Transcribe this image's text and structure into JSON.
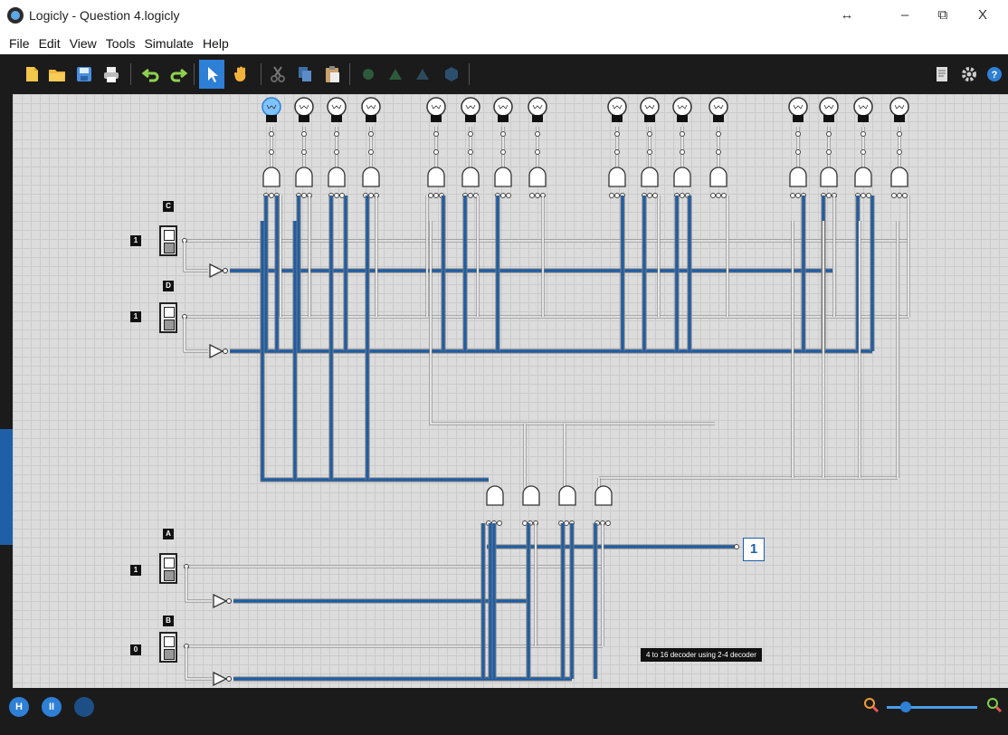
{
  "window": {
    "title": "Logicly - Question 4.logicly",
    "controls": {
      "resize": "↔",
      "minimize": "–",
      "restore": "⧉",
      "close": "X"
    }
  },
  "menu": [
    "File",
    "Edit",
    "View",
    "Tools",
    "Simulate",
    "Help"
  ],
  "toolbar": {
    "icons": [
      "new-file-icon",
      "open-folder-icon",
      "save-icon",
      "print-icon",
      "undo-icon",
      "redo-icon",
      "select-arrow-icon",
      "pan-hand-icon",
      "cut-icon",
      "copy-icon",
      "paste-icon",
      "rotate-icon",
      "flip-horizontal-icon",
      "flip-vertical-icon",
      "align-icon"
    ],
    "right_icons": [
      "properties-icon",
      "gear-icon",
      "help-icon"
    ]
  },
  "circuit": {
    "inputs": [
      {
        "label": "C",
        "value": "1"
      },
      {
        "label": "D",
        "value": "1"
      },
      {
        "label": "A",
        "value": "1"
      },
      {
        "label": "B",
        "value": "0"
      }
    ],
    "output_value": "1",
    "note": "4 to 16 decoder using 2-4 decoder",
    "bulbs_lit": 1,
    "bulbs_total": 16
  },
  "colors": {
    "active_wire": "#1c5ea8",
    "inactive_wire": "#ffffff",
    "toolbar_bg": "#1b1b1b",
    "accent": "#2e7fd6"
  }
}
